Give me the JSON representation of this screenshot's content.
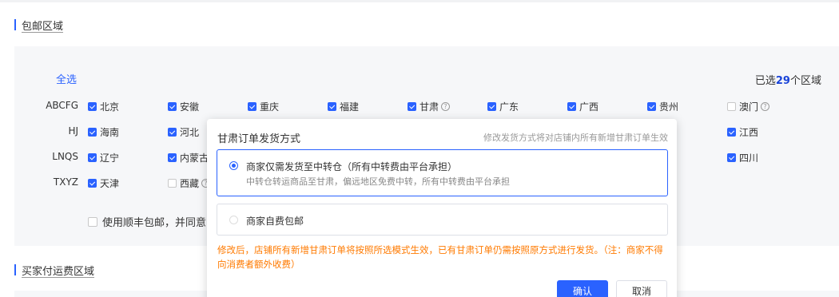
{
  "sections": {
    "free_shipping_title": "包邮区域",
    "buyer_pays_title": "买家付运费区域"
  },
  "select_all": "全选",
  "selected_count": {
    "prefix": "已选",
    "count": "29",
    "suffix": "个区域"
  },
  "groups": {
    "abcfg": "ABCFG",
    "hj": "HJ",
    "lnqs": "LNQS",
    "txyz": "TXYZ"
  },
  "provinces": {
    "beijing": "北京",
    "anhui": "安徽",
    "chongqing": "重庆",
    "fujian": "福建",
    "gansu": "甘肃",
    "guangdong": "广东",
    "guangxi": "广西",
    "guizhou": "贵州",
    "macau": "澳门",
    "hainan": "海南",
    "hebei": "河北",
    "jiangxi": "江西",
    "liaoning": "辽宁",
    "neimenggu": "内蒙古",
    "sichuan": "四川",
    "tianjin": "天津",
    "xizang": "西藏"
  },
  "sf_option": "使用顺丰包邮，并同意",
  "popover": {
    "title": "甘肃订单发货方式",
    "hint": "修改发货方式将对店铺内所有新增甘肃订单生效",
    "option1_main": "商家仅需发货至中转仓（所有中转费由平台承担）",
    "option1_sub": "中转仓转运商品至甘肃，偏远地区免费中转，所有中转费由平台承担",
    "option2_main": "商家自费包邮",
    "warning": "修改后，店铺所有新增甘肃订单将按照所选模式生效，已有甘肃订单仍需按照原方式进行发货。（注：商家不得向消费者额外收费）",
    "confirm": "确认",
    "cancel": "取消"
  },
  "colors": {
    "accent": "#2a62ff",
    "warning": "#ff7a00"
  }
}
